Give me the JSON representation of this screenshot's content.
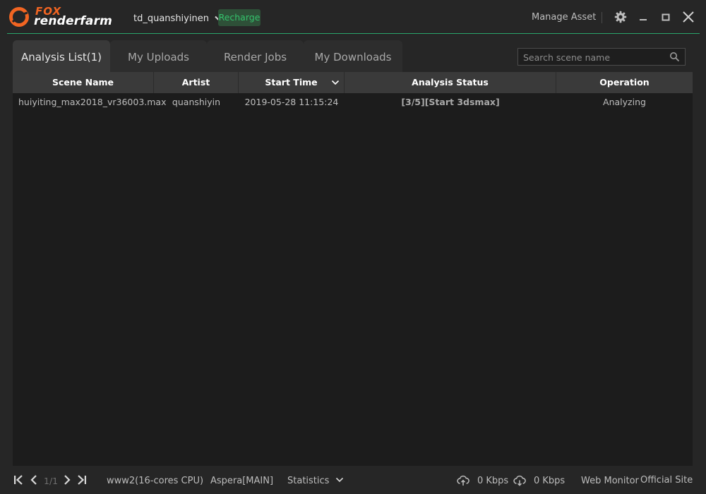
{
  "app": {
    "logo_top": "FOX",
    "logo_bottom": "renderfarm"
  },
  "header": {
    "username": "td_quanshiyinen",
    "recharge_label": "Recharge",
    "manage_asset_label": "Manage Asset"
  },
  "tabs": [
    {
      "label": "Analysis List(1)",
      "active": true
    },
    {
      "label": "My Uploads",
      "active": false
    },
    {
      "label": "Render Jobs",
      "active": false
    },
    {
      "label": "My Downloads",
      "active": false
    }
  ],
  "search": {
    "placeholder": "Search scene name",
    "value": ""
  },
  "table": {
    "columns": [
      "Scene Name",
      "Artist",
      "Start Time",
      "Analysis Status",
      "Operation"
    ],
    "rows": [
      {
        "scene_name": "huiyiting_max2018_vr36003.max",
        "artist": "quanshiyin",
        "start_time": "2019-05-28 11:15:24",
        "analysis_status": "[3/5][Start 3dsmax]",
        "operation": "Analyzing"
      }
    ]
  },
  "statusbar": {
    "page": "1/1",
    "server": "www2(16-cores CPU)",
    "transfer": "Aspera[MAIN]",
    "statistics_label": "Statistics",
    "upload_speed": "0 Kbps",
    "download_speed": "0 Kbps",
    "web_monitor_label": "Web Monitor",
    "official_site_label": "Official Site"
  },
  "colors": {
    "accent_green": "#2aa56b",
    "brand_orange": "#f26522",
    "recharge_text": "#34c26c"
  },
  "icons": {
    "logo": "fox-logo-icon",
    "user_dropdown": "chevron-down-icon",
    "settings": "gear-icon",
    "minimize": "minimize-icon",
    "maximize": "maximize-icon",
    "close": "close-icon",
    "search": "search-icon",
    "sort": "chevron-down-icon",
    "first_page": "first-page-icon",
    "prev_page": "chevron-left-icon",
    "next_page": "chevron-right-icon",
    "last_page": "last-page-icon",
    "upload": "cloud-upload-icon",
    "download": "cloud-download-icon"
  }
}
